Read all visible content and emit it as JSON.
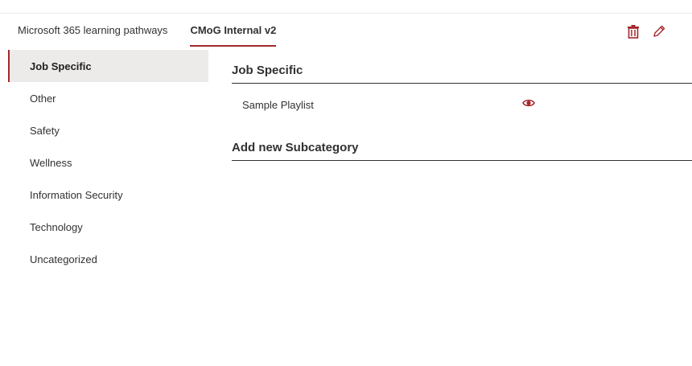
{
  "tabs": [
    {
      "label": "Microsoft 365 learning pathways",
      "active": false
    },
    {
      "label": "CMoG Internal v2",
      "active": true
    }
  ],
  "actions": [
    {
      "icon": "trash-icon"
    },
    {
      "icon": "pencil-icon"
    }
  ],
  "sidebar": {
    "items": [
      {
        "label": "Job Specific",
        "active": true
      },
      {
        "label": "Other"
      },
      {
        "label": "Safety"
      },
      {
        "label": "Wellness"
      },
      {
        "label": "Information Security"
      },
      {
        "label": "Technology"
      },
      {
        "label": "Uncategorized"
      }
    ]
  },
  "main": {
    "heading": "Job Specific",
    "playlists": [
      {
        "title": "Sample Playlist",
        "icon": "eye-icon"
      }
    ],
    "add_heading": "Add new Subcategory"
  },
  "colors": {
    "accent": "#a4262c",
    "selected_bg": "#edebe9",
    "text": "#323130"
  }
}
